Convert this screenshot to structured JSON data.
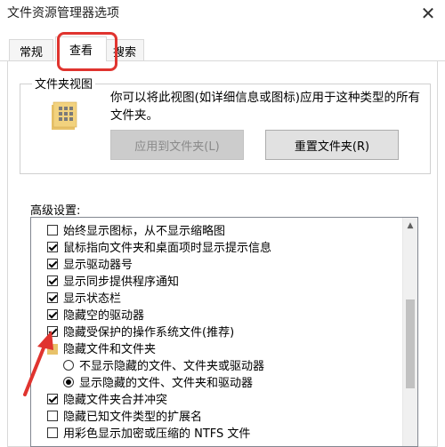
{
  "window": {
    "title": "文件资源管理器选项",
    "close_glyph": "✕"
  },
  "tabs": [
    {
      "label": "常规",
      "active": false
    },
    {
      "label": "查看",
      "active": true
    },
    {
      "label": "搜索",
      "active": false
    }
  ],
  "folder_views": {
    "group_title": "文件夹视图",
    "description": "你可以将此视图(如详细信息或图标)应用于这种类型的所有文件夹。",
    "apply_button": "应用到文件夹(L)",
    "reset_button": "重置文件夹(R)",
    "icon": "folder-view-icon"
  },
  "advanced": {
    "label": "高级设置:",
    "items": [
      {
        "type": "checkbox",
        "checked": false,
        "label": "始终显示图标，从不显示缩略图"
      },
      {
        "type": "checkbox",
        "checked": true,
        "label": "鼠标指向文件夹和桌面项时显示提示信息"
      },
      {
        "type": "checkbox",
        "checked": true,
        "label": "显示驱动器号"
      },
      {
        "type": "checkbox",
        "checked": true,
        "label": "显示同步提供程序通知"
      },
      {
        "type": "checkbox",
        "checked": true,
        "label": "显示状态栏"
      },
      {
        "type": "checkbox",
        "checked": true,
        "label": "隐藏空的驱动器"
      },
      {
        "type": "checkbox",
        "checked": true,
        "label": "隐藏受保护的操作系统文件(推荐)"
      },
      {
        "type": "folder",
        "label": "隐藏文件和文件夹"
      },
      {
        "type": "radio",
        "checked": false,
        "label": "不显示隐藏的文件、文件夹或驱动器"
      },
      {
        "type": "radio",
        "checked": true,
        "label": "显示隐藏的文件、文件夹和驱动器"
      },
      {
        "type": "checkbox",
        "checked": true,
        "label": "隐藏文件夹合并冲突"
      },
      {
        "type": "checkbox",
        "checked": false,
        "label": "隐藏已知文件类型的扩展名"
      },
      {
        "type": "checkbox",
        "checked": false,
        "label": "用彩色显示加密或压缩的 NTFS 文件"
      }
    ]
  },
  "colors": {
    "highlight": "#e0342f",
    "accent": "#0078d7"
  }
}
